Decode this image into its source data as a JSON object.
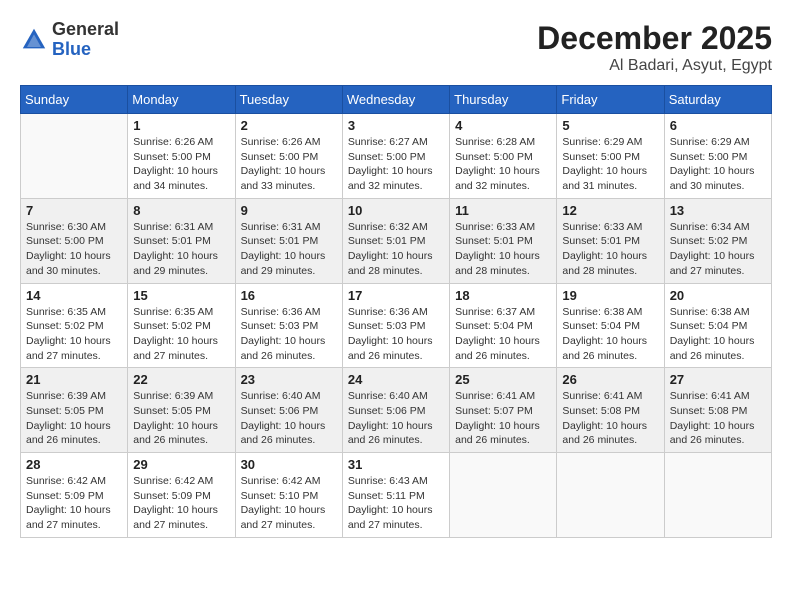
{
  "logo": {
    "text_general": "General",
    "text_blue": "Blue"
  },
  "title": {
    "month": "December 2025",
    "location": "Al Badari, Asyut, Egypt"
  },
  "weekdays": [
    "Sunday",
    "Monday",
    "Tuesday",
    "Wednesday",
    "Thursday",
    "Friday",
    "Saturday"
  ],
  "weeks": [
    {
      "shaded": false,
      "days": [
        {
          "empty": true
        },
        {
          "num": "1",
          "sunrise": "6:26 AM",
          "sunset": "5:00 PM",
          "daylight": "10 hours and 34 minutes."
        },
        {
          "num": "2",
          "sunrise": "6:26 AM",
          "sunset": "5:00 PM",
          "daylight": "10 hours and 33 minutes."
        },
        {
          "num": "3",
          "sunrise": "6:27 AM",
          "sunset": "5:00 PM",
          "daylight": "10 hours and 32 minutes."
        },
        {
          "num": "4",
          "sunrise": "6:28 AM",
          "sunset": "5:00 PM",
          "daylight": "10 hours and 32 minutes."
        },
        {
          "num": "5",
          "sunrise": "6:29 AM",
          "sunset": "5:00 PM",
          "daylight": "10 hours and 31 minutes."
        },
        {
          "num": "6",
          "sunrise": "6:29 AM",
          "sunset": "5:00 PM",
          "daylight": "10 hours and 30 minutes."
        }
      ]
    },
    {
      "shaded": true,
      "days": [
        {
          "num": "7",
          "sunrise": "6:30 AM",
          "sunset": "5:00 PM",
          "daylight": "10 hours and 30 minutes."
        },
        {
          "num": "8",
          "sunrise": "6:31 AM",
          "sunset": "5:01 PM",
          "daylight": "10 hours and 29 minutes."
        },
        {
          "num": "9",
          "sunrise": "6:31 AM",
          "sunset": "5:01 PM",
          "daylight": "10 hours and 29 minutes."
        },
        {
          "num": "10",
          "sunrise": "6:32 AM",
          "sunset": "5:01 PM",
          "daylight": "10 hours and 28 minutes."
        },
        {
          "num": "11",
          "sunrise": "6:33 AM",
          "sunset": "5:01 PM",
          "daylight": "10 hours and 28 minutes."
        },
        {
          "num": "12",
          "sunrise": "6:33 AM",
          "sunset": "5:01 PM",
          "daylight": "10 hours and 28 minutes."
        },
        {
          "num": "13",
          "sunrise": "6:34 AM",
          "sunset": "5:02 PM",
          "daylight": "10 hours and 27 minutes."
        }
      ]
    },
    {
      "shaded": false,
      "days": [
        {
          "num": "14",
          "sunrise": "6:35 AM",
          "sunset": "5:02 PM",
          "daylight": "10 hours and 27 minutes."
        },
        {
          "num": "15",
          "sunrise": "6:35 AM",
          "sunset": "5:02 PM",
          "daylight": "10 hours and 27 minutes."
        },
        {
          "num": "16",
          "sunrise": "6:36 AM",
          "sunset": "5:03 PM",
          "daylight": "10 hours and 26 minutes."
        },
        {
          "num": "17",
          "sunrise": "6:36 AM",
          "sunset": "5:03 PM",
          "daylight": "10 hours and 26 minutes."
        },
        {
          "num": "18",
          "sunrise": "6:37 AM",
          "sunset": "5:04 PM",
          "daylight": "10 hours and 26 minutes."
        },
        {
          "num": "19",
          "sunrise": "6:38 AM",
          "sunset": "5:04 PM",
          "daylight": "10 hours and 26 minutes."
        },
        {
          "num": "20",
          "sunrise": "6:38 AM",
          "sunset": "5:04 PM",
          "daylight": "10 hours and 26 minutes."
        }
      ]
    },
    {
      "shaded": true,
      "days": [
        {
          "num": "21",
          "sunrise": "6:39 AM",
          "sunset": "5:05 PM",
          "daylight": "10 hours and 26 minutes."
        },
        {
          "num": "22",
          "sunrise": "6:39 AM",
          "sunset": "5:05 PM",
          "daylight": "10 hours and 26 minutes."
        },
        {
          "num": "23",
          "sunrise": "6:40 AM",
          "sunset": "5:06 PM",
          "daylight": "10 hours and 26 minutes."
        },
        {
          "num": "24",
          "sunrise": "6:40 AM",
          "sunset": "5:06 PM",
          "daylight": "10 hours and 26 minutes."
        },
        {
          "num": "25",
          "sunrise": "6:41 AM",
          "sunset": "5:07 PM",
          "daylight": "10 hours and 26 minutes."
        },
        {
          "num": "26",
          "sunrise": "6:41 AM",
          "sunset": "5:08 PM",
          "daylight": "10 hours and 26 minutes."
        },
        {
          "num": "27",
          "sunrise": "6:41 AM",
          "sunset": "5:08 PM",
          "daylight": "10 hours and 26 minutes."
        }
      ]
    },
    {
      "shaded": false,
      "days": [
        {
          "num": "28",
          "sunrise": "6:42 AM",
          "sunset": "5:09 PM",
          "daylight": "10 hours and 27 minutes."
        },
        {
          "num": "29",
          "sunrise": "6:42 AM",
          "sunset": "5:09 PM",
          "daylight": "10 hours and 27 minutes."
        },
        {
          "num": "30",
          "sunrise": "6:42 AM",
          "sunset": "5:10 PM",
          "daylight": "10 hours and 27 minutes."
        },
        {
          "num": "31",
          "sunrise": "6:43 AM",
          "sunset": "5:11 PM",
          "daylight": "10 hours and 27 minutes."
        },
        {
          "empty": true
        },
        {
          "empty": true
        },
        {
          "empty": true
        }
      ]
    }
  ]
}
